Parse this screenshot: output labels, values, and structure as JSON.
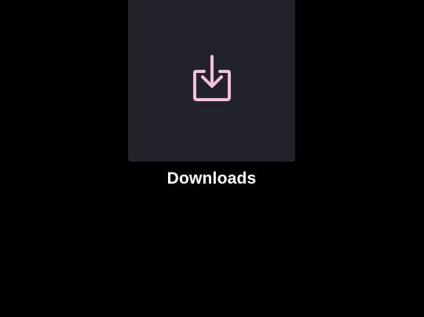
{
  "folder": {
    "label": "Downloads",
    "icon": "download-icon"
  },
  "colors": {
    "background": "#000000",
    "tile_background": "#22232a",
    "icon": "#f1bfe0",
    "label": "#ffffff"
  }
}
